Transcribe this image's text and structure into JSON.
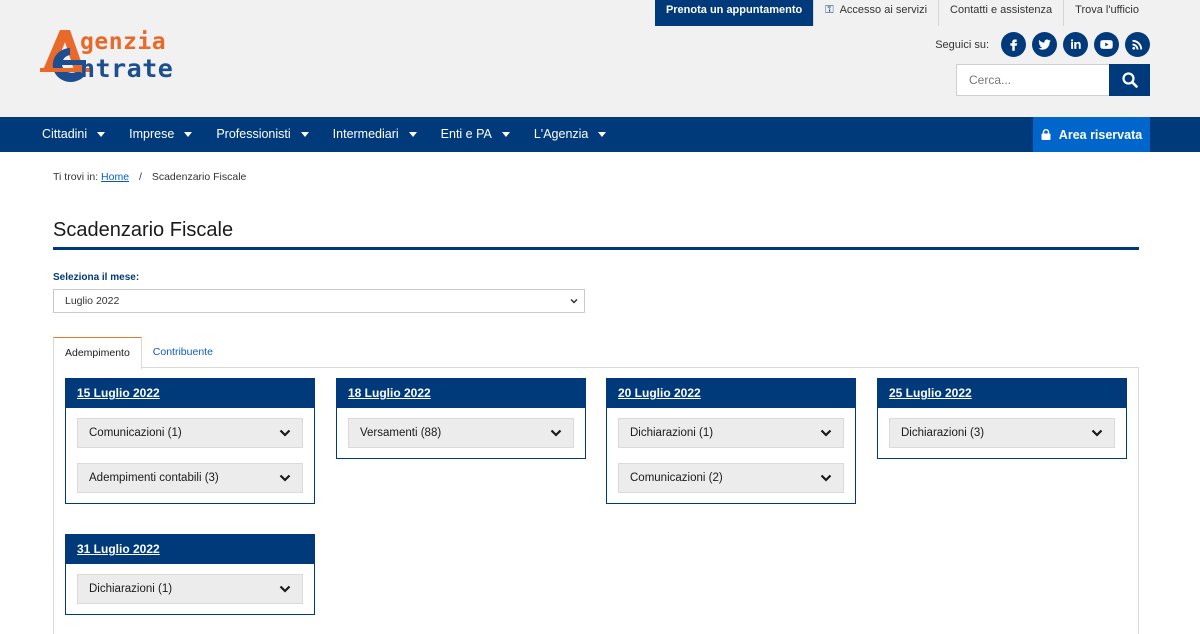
{
  "header": {
    "logo": {
      "word1": "genzia",
      "word2": "ntrate",
      "mark_letters": "AE",
      "colors": {
        "orange": "#e8692a",
        "blue": "#1d4e8f"
      }
    },
    "utility_links": [
      {
        "label": "Prenota un appuntamento",
        "primary": true
      },
      {
        "label": "Accesso ai servizi",
        "icon": "key-icon"
      },
      {
        "label": "Contatti e assistenza"
      },
      {
        "label": "Trova l'ufficio"
      }
    ],
    "social": {
      "label": "Seguici su:",
      "icons": [
        "facebook-icon",
        "twitter-icon",
        "linkedin-icon",
        "youtube-icon",
        "rss-icon"
      ]
    },
    "search": {
      "placeholder": "Cerca...",
      "value": ""
    }
  },
  "nav": {
    "items": [
      {
        "label": "Cittadini"
      },
      {
        "label": "Imprese"
      },
      {
        "label": "Professionisti"
      },
      {
        "label": "Intermediari"
      },
      {
        "label": "Enti e PA"
      },
      {
        "label": "L'Agenzia"
      }
    ],
    "area_riservata": "Area riservata",
    "colors": {
      "bar": "#003a7a",
      "area": "#0066cc"
    }
  },
  "breadcrumb": {
    "prefix": "Ti trovi in:",
    "home": "Home",
    "separator": "/",
    "current": "Scadenzario Fiscale"
  },
  "page": {
    "title": "Scadenzario Fiscale",
    "month_label": "Seleziona il mese:",
    "month_value": "Luglio 2022",
    "tabs": [
      {
        "label": "Adempimento",
        "active": true
      },
      {
        "label": "Contribuente",
        "active": false
      }
    ]
  },
  "cards": [
    {
      "date": "15 Luglio 2022",
      "items": [
        "Comunicazioni (1)",
        "Adempimenti contabili (3)"
      ]
    },
    {
      "date": "18 Luglio 2022",
      "items": [
        "Versamenti (88)"
      ]
    },
    {
      "date": "20 Luglio 2022",
      "items": [
        "Dichiarazioni (1)",
        "Comunicazioni (2)"
      ]
    },
    {
      "date": "25 Luglio 2022",
      "items": [
        "Dichiarazioni (3)"
      ]
    },
    {
      "date": "31 Luglio 2022",
      "items": [
        "Dichiarazioni (1)"
      ]
    }
  ]
}
